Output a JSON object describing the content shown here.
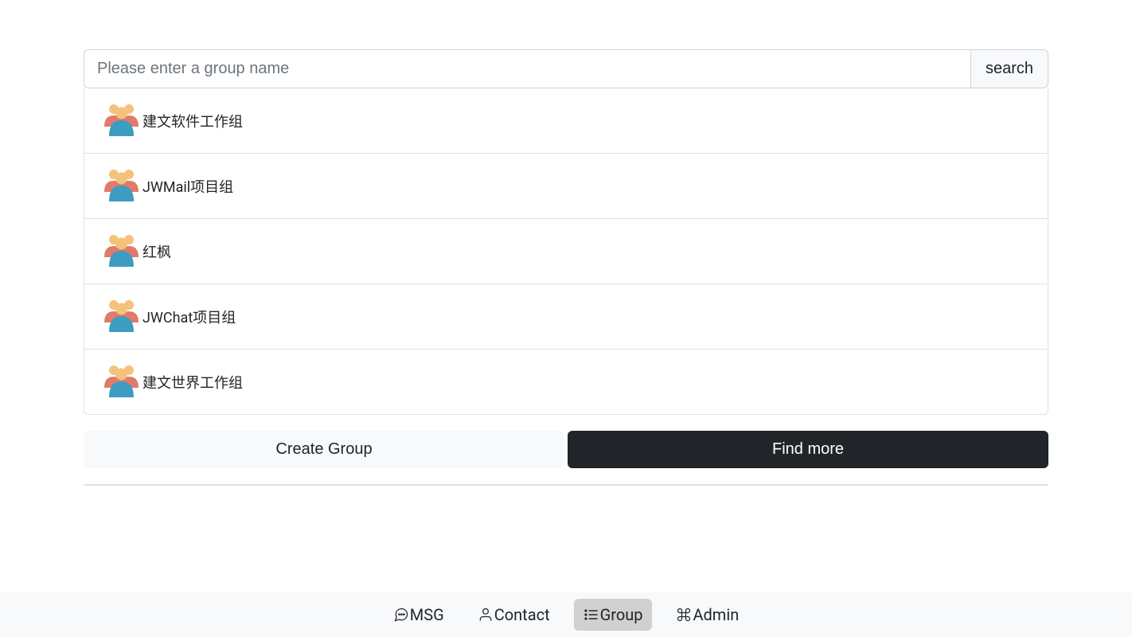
{
  "search": {
    "placeholder": "Please enter a group name",
    "button_label": "search"
  },
  "groups": [
    {
      "name": "建文软件工作组"
    },
    {
      "name": "JWMail项目组"
    },
    {
      "name": "红枫"
    },
    {
      "name": "JWChat项目组"
    },
    {
      "name": "建文世界工作组"
    }
  ],
  "actions": {
    "create_label": "Create Group",
    "find_label": "Find more"
  },
  "nav": {
    "msg": "MSG",
    "contact": "Contact",
    "group": "Group",
    "admin": "Admin"
  }
}
